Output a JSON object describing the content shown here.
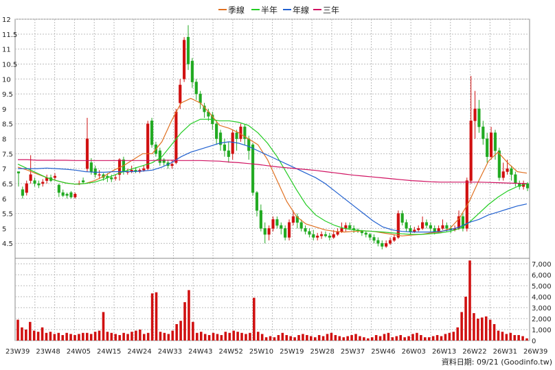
{
  "chart_data": {
    "type": "candlestick",
    "legend": [
      {
        "label": "季線",
        "color": "#e07020"
      },
      {
        "label": "半年",
        "color": "#22cc22"
      },
      {
        "label": "年線",
        "color": "#2060d0"
      },
      {
        "label": "三年",
        "color": "#d01060"
      }
    ],
    "price_axis": {
      "ylim": [
        4,
        12
      ],
      "ticks": [
        "4.5",
        "5",
        "5.5",
        "6",
        "6.5",
        "7",
        "7.5",
        "8",
        "8.5",
        "9",
        "9.5",
        "10",
        "10.5",
        "11",
        "11.5",
        "12"
      ]
    },
    "volume_axis": {
      "ylim": [
        0,
        7500
      ],
      "ticks": [
        "0",
        "1,000",
        "2,000",
        "3,000",
        "4,000",
        "5,000",
        "6,000",
        "7,000"
      ]
    },
    "x_labels": [
      "23W39",
      "23W48",
      "24W05",
      "24W15",
      "24W24",
      "24W33",
      "24W43",
      "24W52",
      "25W10",
      "25W19",
      "25W28",
      "25W37",
      "25W46",
      "26W03",
      "26W13",
      "26W22",
      "26W31",
      "26W39"
    ],
    "footer": "資料日期: 09/21 (Goodinfo.tw)",
    "colors": {
      "up": "#d01010",
      "down": "#22aa22",
      "volume": "#d01010",
      "grid": "#bbbbbb"
    },
    "series_ma": [
      {
        "name": "季線",
        "color": "#e07020",
        "values": [
          7.05,
          6.95,
          6.82,
          6.7,
          6.6,
          6.52,
          6.48,
          6.5,
          6.6,
          6.75,
          6.95,
          7.1,
          7.3,
          7.5,
          7.5,
          7.9,
          8.6,
          9.2,
          9.35,
          9.2,
          8.85,
          8.45,
          8.35,
          8.2,
          8.0,
          7.8,
          7.3,
          6.6,
          5.9,
          5.4,
          5.15,
          5.05,
          4.95,
          4.9,
          4.88,
          4.9,
          4.92,
          4.9,
          4.85,
          4.8,
          4.75,
          4.78,
          4.8,
          4.85,
          4.88,
          5.0,
          5.35,
          5.9,
          6.6,
          7.25,
          7.55,
          7.2,
          6.9,
          6.85
        ]
      },
      {
        "name": "半年",
        "color": "#22cc22",
        "values": [
          7.15,
          7.0,
          6.85,
          6.7,
          6.6,
          6.52,
          6.48,
          6.5,
          6.55,
          6.65,
          6.78,
          6.9,
          7.0,
          7.1,
          7.2,
          7.4,
          7.8,
          8.2,
          8.5,
          8.65,
          8.65,
          8.6,
          8.6,
          8.55,
          8.45,
          8.2,
          7.85,
          7.4,
          6.85,
          6.3,
          5.8,
          5.45,
          5.25,
          5.1,
          5.0,
          4.95,
          4.92,
          4.9,
          4.88,
          4.85,
          4.82,
          4.8,
          4.8,
          4.82,
          4.85,
          4.9,
          5.0,
          5.2,
          5.5,
          5.8,
          6.05,
          6.25,
          6.4,
          6.5
        ]
      },
      {
        "name": "年線",
        "color": "#2060d0",
        "values": [
          7.0,
          7.0,
          7.0,
          7.02,
          7.0,
          6.98,
          6.95,
          6.9,
          6.88,
          6.88,
          6.9,
          6.9,
          6.9,
          6.92,
          6.95,
          7.05,
          7.2,
          7.4,
          7.55,
          7.65,
          7.75,
          7.85,
          7.9,
          7.85,
          7.75,
          7.6,
          7.45,
          7.3,
          7.15,
          7.0,
          6.85,
          6.7,
          6.5,
          6.25,
          6.0,
          5.75,
          5.5,
          5.25,
          5.05,
          4.95,
          4.9,
          4.88,
          4.88,
          4.88,
          4.9,
          4.95,
          5.05,
          5.2,
          5.3,
          5.45,
          5.55,
          5.65,
          5.75,
          5.82
        ]
      },
      {
        "name": "三年",
        "color": "#d01060",
        "values": [
          7.3,
          7.3,
          7.28,
          7.28,
          7.28,
          7.28,
          7.27,
          7.27,
          7.27,
          7.27,
          7.27,
          7.27,
          7.27,
          7.27,
          7.27,
          7.28,
          7.28,
          7.27,
          7.27,
          7.27,
          7.26,
          7.25,
          7.22,
          7.2,
          7.17,
          7.14,
          7.1,
          7.06,
          7.03,
          7.0,
          6.97,
          6.94,
          6.9,
          6.86,
          6.82,
          6.78,
          6.75,
          6.72,
          6.69,
          6.66,
          6.63,
          6.6,
          6.58,
          6.56,
          6.55,
          6.55,
          6.55,
          6.55,
          6.55,
          6.54,
          6.53,
          6.52,
          6.51,
          6.5
        ]
      }
    ],
    "candles": [
      [
        6.9,
        6.85,
        6.9,
        6.4
      ],
      [
        6.3,
        6.1,
        6.4,
        6.0
      ],
      [
        6.2,
        6.5,
        6.6,
        6.1
      ],
      [
        6.6,
        6.8,
        7.45,
        6.5
      ],
      [
        6.6,
        6.5,
        6.7,
        6.4
      ],
      [
        6.5,
        6.45,
        6.6,
        6.35
      ],
      [
        6.5,
        6.55,
        6.65,
        6.4
      ],
      [
        6.6,
        6.7,
        6.8,
        6.5
      ],
      [
        6.7,
        6.6,
        6.8,
        6.55
      ],
      [
        6.7,
        6.75,
        6.85,
        6.6
      ],
      [
        6.45,
        6.2,
        6.5,
        6.05
      ],
      [
        6.2,
        6.1,
        6.3,
        6.05
      ],
      [
        6.15,
        6.1,
        6.2,
        6.0
      ],
      [
        6.2,
        6.05,
        6.25,
        6.0
      ],
      [
        6.05,
        6.15,
        6.2,
        6.0
      ],
      [
        6.5,
        6.5,
        6.6,
        6.45
      ],
      [
        6.6,
        6.55,
        6.7,
        6.5
      ],
      [
        7.0,
        8.0,
        8.7,
        6.9
      ],
      [
        7.2,
        6.9,
        7.35,
        6.8
      ],
      [
        7.0,
        6.8,
        7.1,
        6.7
      ],
      [
        6.8,
        6.8,
        6.95,
        6.65
      ],
      [
        6.8,
        6.7,
        6.85,
        6.6
      ],
      [
        6.75,
        6.7,
        6.85,
        6.55
      ],
      [
        6.7,
        6.65,
        6.8,
        6.55
      ],
      [
        6.7,
        6.7,
        6.8,
        6.6
      ],
      [
        6.8,
        7.3,
        7.35,
        6.6
      ],
      [
        7.3,
        6.9,
        7.4,
        6.8
      ],
      [
        6.9,
        6.9,
        7.0,
        6.8
      ],
      [
        6.9,
        6.95,
        7.1,
        6.85
      ],
      [
        6.95,
        6.9,
        7.05,
        6.85
      ],
      [
        6.9,
        6.95,
        7.0,
        6.85
      ],
      [
        6.95,
        7.0,
        7.1,
        6.9
      ],
      [
        7.0,
        8.5,
        8.6,
        6.95
      ],
      [
        8.6,
        7.8,
        8.7,
        7.7
      ],
      [
        7.8,
        7.5,
        7.9,
        7.4
      ],
      [
        7.6,
        7.2,
        7.7,
        7.1
      ],
      [
        7.3,
        7.2,
        7.35,
        7.1
      ],
      [
        7.2,
        7.1,
        7.3,
        7.0
      ],
      [
        7.1,
        7.15,
        7.3,
        7.0
      ],
      [
        7.2,
        8.9,
        9.0,
        7.15
      ],
      [
        9.2,
        9.8,
        10.0,
        9.0
      ],
      [
        10.0,
        11.3,
        11.4,
        9.9
      ],
      [
        11.4,
        10.5,
        11.8,
        10.3
      ],
      [
        10.6,
        9.9,
        10.7,
        9.7
      ],
      [
        9.9,
        9.5,
        10.0,
        9.3
      ],
      [
        9.5,
        9.2,
        9.6,
        9.0
      ],
      [
        9.1,
        8.9,
        9.2,
        8.7
      ],
      [
        8.9,
        8.75,
        9.0,
        8.6
      ],
      [
        8.8,
        8.5,
        8.9,
        8.3
      ],
      [
        8.5,
        8.0,
        8.6,
        7.8
      ],
      [
        8.2,
        7.8,
        8.3,
        7.6
      ],
      [
        7.8,
        7.6,
        8.0,
        7.4
      ],
      [
        7.6,
        7.4,
        7.9,
        7.2
      ],
      [
        7.5,
        8.2,
        8.3,
        7.3
      ],
      [
        8.2,
        8.0,
        8.3,
        7.6
      ],
      [
        8.0,
        8.4,
        8.5,
        7.9
      ],
      [
        8.4,
        8.0,
        8.5,
        7.8
      ],
      [
        8.0,
        7.6,
        8.1,
        7.3
      ],
      [
        7.8,
        6.2,
        7.85,
        6.1
      ],
      [
        6.2,
        5.6,
        6.25,
        5.4
      ],
      [
        5.6,
        5.0,
        5.8,
        4.9
      ],
      [
        5.0,
        4.8,
        5.2,
        4.5
      ],
      [
        4.8,
        5.0,
        5.1,
        4.6
      ],
      [
        5.0,
        5.3,
        5.4,
        4.9
      ],
      [
        5.3,
        5.1,
        5.4,
        5.0
      ],
      [
        5.1,
        5.0,
        5.2,
        4.8
      ],
      [
        5.0,
        4.7,
        5.1,
        4.6
      ],
      [
        4.7,
        5.2,
        5.3,
        4.6
      ],
      [
        5.2,
        5.4,
        5.6,
        5.1
      ],
      [
        5.4,
        5.2,
        5.5,
        5.0
      ],
      [
        5.2,
        5.0,
        5.3,
        4.9
      ],
      [
        5.0,
        4.9,
        5.1,
        4.8
      ],
      [
        4.9,
        4.8,
        5.0,
        4.7
      ],
      [
        4.8,
        4.7,
        4.95,
        4.6
      ],
      [
        4.7,
        4.75,
        4.85,
        4.6
      ],
      [
        4.75,
        4.8,
        4.9,
        4.65
      ],
      [
        4.8,
        4.75,
        4.9,
        4.7
      ],
      [
        4.75,
        4.7,
        4.85,
        4.6
      ],
      [
        4.7,
        4.8,
        4.95,
        4.65
      ],
      [
        4.8,
        4.9,
        5.0,
        4.75
      ],
      [
        4.9,
        5.0,
        5.2,
        4.85
      ],
      [
        5.0,
        5.1,
        5.2,
        4.9
      ],
      [
        5.1,
        5.0,
        5.2,
        4.95
      ],
      [
        5.0,
        4.95,
        5.1,
        4.85
      ],
      [
        4.95,
        4.9,
        5.0,
        4.85
      ],
      [
        4.9,
        4.85,
        4.95,
        4.75
      ],
      [
        4.85,
        4.8,
        4.9,
        4.7
      ],
      [
        4.8,
        4.7,
        4.85,
        4.6
      ],
      [
        4.7,
        4.6,
        4.8,
        4.5
      ],
      [
        4.6,
        4.5,
        4.7,
        4.4
      ],
      [
        4.5,
        4.4,
        4.6,
        4.3
      ],
      [
        4.4,
        4.5,
        4.6,
        4.35
      ],
      [
        4.5,
        4.6,
        4.7,
        4.45
      ],
      [
        4.6,
        4.7,
        4.8,
        4.55
      ],
      [
        4.7,
        5.5,
        5.6,
        4.65
      ],
      [
        5.5,
        5.2,
        5.6,
        5.1
      ],
      [
        5.2,
        5.0,
        5.3,
        4.9
      ],
      [
        5.0,
        4.9,
        5.1,
        4.8
      ],
      [
        4.9,
        4.95,
        5.05,
        4.85
      ],
      [
        4.95,
        5.0,
        5.1,
        4.9
      ],
      [
        5.0,
        5.2,
        5.4,
        4.95
      ],
      [
        5.2,
        5.1,
        5.3,
        5.0
      ],
      [
        5.1,
        5.0,
        5.2,
        4.9
      ],
      [
        5.0,
        4.9,
        5.1,
        4.8
      ],
      [
        4.9,
        5.0,
        5.1,
        4.85
      ],
      [
        5.0,
        5.1,
        5.3,
        4.95
      ],
      [
        5.1,
        5.0,
        5.2,
        4.9
      ],
      [
        5.0,
        4.95,
        5.1,
        4.85
      ],
      [
        4.95,
        5.0,
        5.1,
        4.9
      ],
      [
        5.0,
        5.4,
        5.6,
        4.95
      ],
      [
        5.4,
        5.0,
        5.5,
        4.9
      ],
      [
        5.0,
        6.6,
        6.7,
        4.9
      ],
      [
        6.6,
        8.6,
        10.1,
        6.5
      ],
      [
        8.6,
        9.0,
        9.6,
        8.0
      ],
      [
        9.0,
        8.4,
        9.3,
        8.2
      ],
      [
        8.4,
        8.0,
        8.6,
        7.8
      ],
      [
        8.0,
        7.4,
        8.2,
        7.2
      ],
      [
        7.4,
        8.2,
        8.4,
        7.3
      ],
      [
        8.2,
        7.6,
        8.3,
        7.3
      ],
      [
        7.6,
        6.7,
        7.7,
        6.6
      ],
      [
        6.7,
        6.9,
        7.2,
        6.6
      ],
      [
        6.9,
        7.0,
        7.3,
        6.8
      ],
      [
        7.0,
        6.8,
        7.1,
        6.6
      ],
      [
        6.8,
        6.5,
        6.9,
        6.4
      ],
      [
        6.5,
        6.4,
        6.6,
        6.3
      ],
      [
        6.4,
        6.5,
        6.6,
        6.3
      ],
      [
        6.5,
        6.35,
        6.55,
        6.25
      ]
    ],
    "volumes": [
      1900,
      1200,
      1000,
      1700,
      900,
      800,
      1200,
      700,
      800,
      600,
      700,
      500,
      700,
      600,
      500,
      600,
      700,
      700,
      600,
      800,
      900,
      2600,
      800,
      700,
      600,
      500,
      700,
      600,
      800,
      900,
      1000,
      600,
      700,
      4300,
      4400,
      800,
      700,
      600,
      900,
      1500,
      1800,
      3500,
      4600,
      1700,
      700,
      800,
      600,
      500,
      700,
      600,
      500,
      800,
      700,
      900,
      800,
      700,
      600,
      700,
      3900,
      800,
      600,
      300,
      400,
      300,
      500,
      700,
      500,
      400,
      300,
      500,
      600,
      500,
      400,
      300,
      500,
      400,
      600,
      700,
      500,
      400,
      300,
      400,
      500,
      600,
      400,
      300,
      200,
      300,
      500,
      400,
      600,
      700,
      300,
      400,
      500,
      300,
      400,
      600,
      700,
      500,
      300,
      300,
      400,
      500,
      400,
      600,
      700,
      800,
      1200,
      2600,
      4000,
      7300,
      2500,
      2000,
      2100,
      2200,
      1900,
      1500,
      900,
      800,
      600,
      700,
      500,
      500,
      400,
      200
    ]
  }
}
